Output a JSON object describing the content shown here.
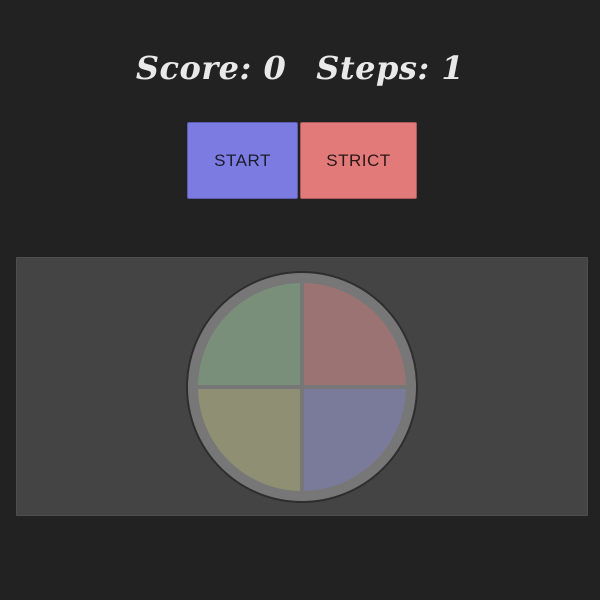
{
  "score": {
    "score_text": "Score: 0",
    "steps_text": "Steps: 1"
  },
  "controls": {
    "start_label": "START",
    "strict_label": "STRICT"
  },
  "colors": {
    "start": "#7b7be2",
    "strict": "#e27a7a",
    "pad_green": "#7a8f7a",
    "pad_red": "#9b7373",
    "pad_yellow": "#8f8f73",
    "pad_blue": "#7a7a9a"
  }
}
